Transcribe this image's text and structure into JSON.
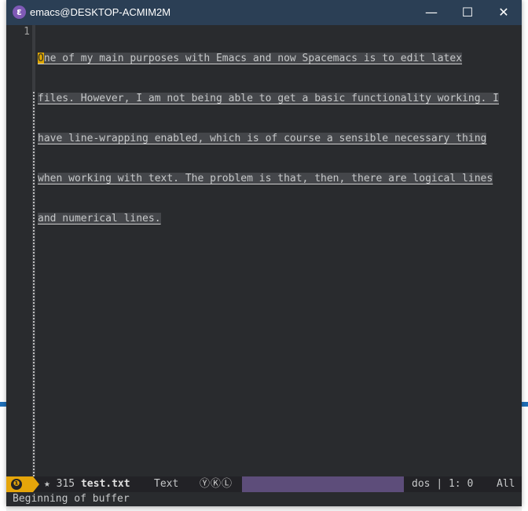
{
  "window": {
    "title": "emacs@DESKTOP-ACMIM2M",
    "app_icon_glyph": "ε",
    "minimize_glyph": "—",
    "maximize_glyph": "☐",
    "close_glyph": "✕"
  },
  "editor": {
    "line_number": "1",
    "cursor_char": "O",
    "lines": [
      "ne of my main purposes with Emacs and now Spacemacs is to edit latex",
      "files. However, I am not being able to get a basic functionality working. I",
      "have line-wrapping enabled, which is of course a sensible necessary thing",
      "when working with text. The problem is that, then, there are logical lines",
      "and numerical lines."
    ]
  },
  "modeline": {
    "badge_glyph": "❶",
    "modified_marker": "★",
    "buffer_size": "315",
    "file_name": "test.txt",
    "major_mode": "Text",
    "minor_modes": "ⓎⓀⓁ",
    "encoding": "dos",
    "separator": "|",
    "position": "1: 0",
    "scroll": "All"
  },
  "echo_area": {
    "message": "Beginning of buffer"
  },
  "colors": {
    "titlebar": "#2b3f55",
    "editor_bg": "#292b2e",
    "accent": "#e5a50a",
    "modeline_fill": "#5d4d7a"
  }
}
